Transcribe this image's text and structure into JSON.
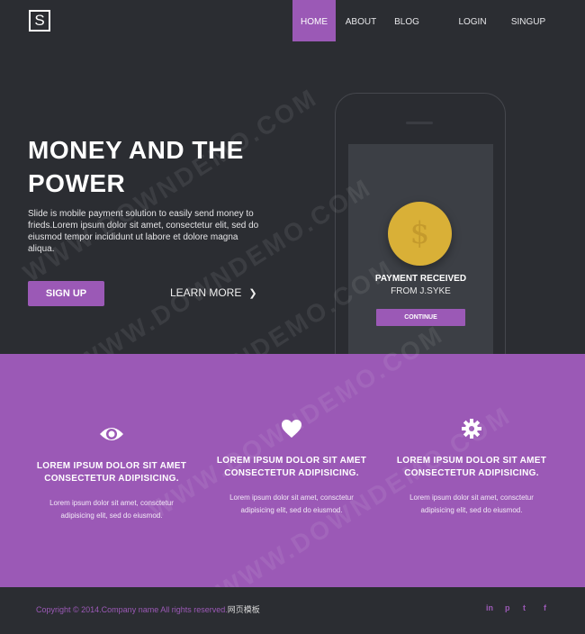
{
  "brand": {
    "logo_letter": "S"
  },
  "nav": {
    "items": [
      "HOME",
      "ABOUT",
      "BLOG",
      "LOGIN",
      "SINGUP"
    ],
    "active": "HOME"
  },
  "hero": {
    "title_line1": "MONEY AND THE",
    "title_line2": "POWER",
    "text": "Slide is mobile payment solution to easily send money to frieds.Lorem ipsum dolor sit amet, consectetur elit, sed do eiusmod tempor incididunt ut labore et dolore magna aliqua.",
    "signup_label": "SIGN UP",
    "learn_more_label": "LEARN MORE"
  },
  "phone": {
    "currency_symbol": "$",
    "payment_title": "PAYMENT RECEIVED",
    "payment_from": "FROM J.SYKE",
    "continue_label": "CONTINUE"
  },
  "features": [
    {
      "icon": "eye-icon",
      "title_line1": "LOREM IPSUM DOLOR SIT AMET",
      "title_line2": "CONSECTETUR ADIPISICING.",
      "text_line1": "Lorem ipsum dolor sit amet, consctetur",
      "text_line2": "adipisicing elit, sed do eiusmod."
    },
    {
      "icon": "heart-icon",
      "title_line1": "LOREM IPSUM DOLOR SIT AMET",
      "title_line2": "CONSECTETUR ADIPISICING.",
      "text_line1": "Lorem ipsum dolor sit amet, consctetur",
      "text_line2": "adipisicing elit, sed do eiusmod."
    },
    {
      "icon": "gear-icon",
      "title_line1": "LOREM IPSUM DOLOR SIT AMET",
      "title_line2": "CONSECTETUR ADIPISICING.",
      "text_line1": "Lorem ipsum dolor sit amet, consctetur",
      "text_line2": "adipisicing elit, sed do eiusmod."
    }
  ],
  "footer": {
    "copyright": "Copyright © 2014.Company name All rights reserved.",
    "copyright_cn": "网页模板",
    "social": [
      "in",
      "p",
      "t",
      "f"
    ]
  },
  "watermark": "WWW.DOWNDEMO.COM",
  "colors": {
    "accent": "#9b59b6",
    "dark": "#2b2d32",
    "coin": "#d9b037"
  }
}
